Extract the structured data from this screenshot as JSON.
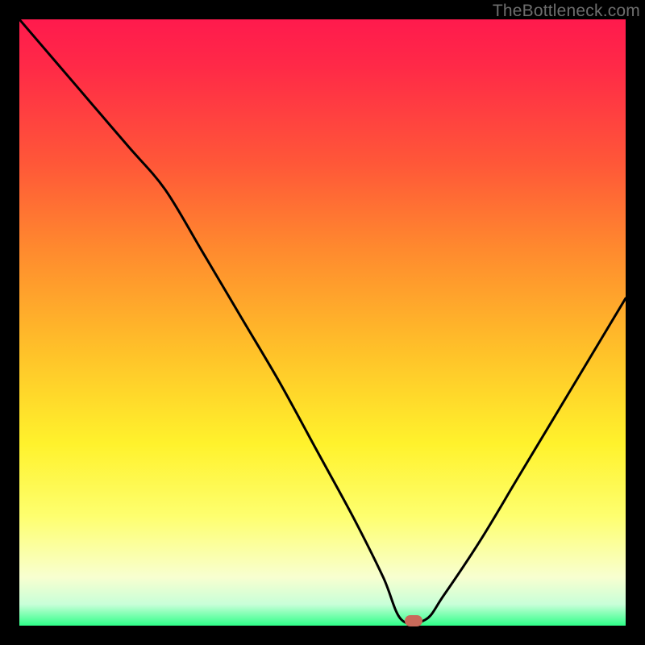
{
  "watermark": "TheBottleneck.com",
  "marker": {
    "x_pct": 65.0,
    "y_pct": 99.2
  },
  "chart_data": {
    "type": "line",
    "title": "",
    "xlabel": "",
    "ylabel": "",
    "xlim": [
      0,
      100
    ],
    "ylim": [
      0,
      100
    ],
    "grid": false,
    "legend": false,
    "background_gradient": {
      "orientation": "vertical",
      "stops": [
        {
          "pct": 0,
          "color": "#ff1a4d"
        },
        {
          "pct": 24,
          "color": "#ff5838"
        },
        {
          "pct": 55,
          "color": "#ffc229"
        },
        {
          "pct": 82,
          "color": "#feff6f"
        },
        {
          "pct": 96,
          "color": "#c8ffd8"
        },
        {
          "pct": 100,
          "color": "#2eff88"
        }
      ]
    },
    "series": [
      {
        "name": "bottleneck-curve",
        "color": "#000000",
        "x": [
          0,
          6,
          12,
          18,
          24,
          30,
          36.5,
          43,
          49,
          55,
          60,
          63,
          67,
          70,
          76,
          82,
          88,
          94,
          100
        ],
        "y": [
          100,
          93,
          86,
          79,
          72,
          62,
          51,
          40,
          29,
          18,
          8,
          1,
          1,
          5,
          14,
          24,
          34,
          44,
          54
        ]
      }
    ],
    "annotations": [
      {
        "name": "optimal-point",
        "x": 65.0,
        "y": 0.8,
        "shape": "pill",
        "color": "#c96a5a"
      }
    ]
  }
}
